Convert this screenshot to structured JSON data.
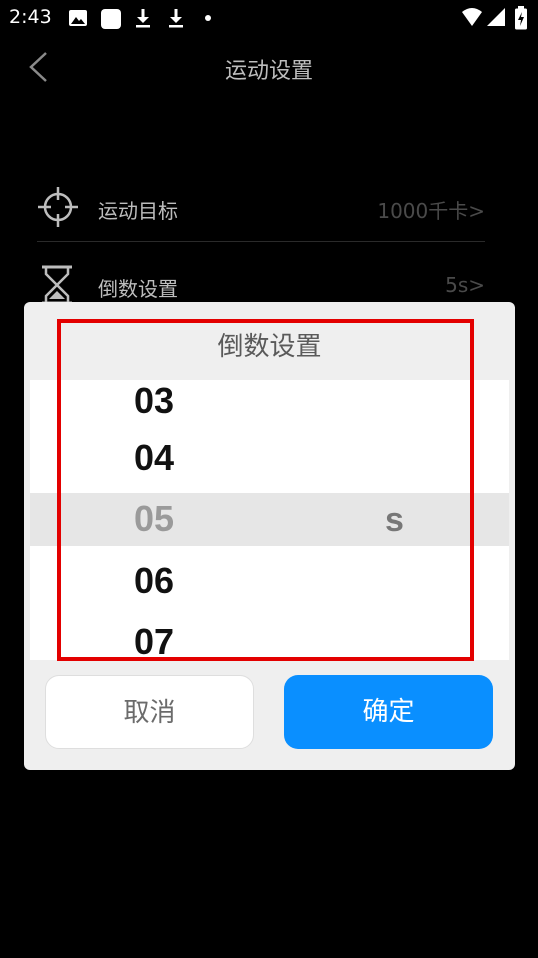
{
  "status_bar": {
    "time": "2:43",
    "icons": [
      "gallery-icon",
      "square-icon",
      "download-icon",
      "download-icon",
      "dot-icon",
      "wifi-icon",
      "signal-icon",
      "battery-icon"
    ]
  },
  "header": {
    "title": "运动设置"
  },
  "settings": {
    "goal": {
      "label": "运动目标",
      "value": "1000千卡>"
    },
    "countdown": {
      "label": "倒数设置",
      "value": "5s>"
    }
  },
  "dialog": {
    "title": "倒数设置",
    "picker_items": [
      "03",
      "04",
      "05",
      "06",
      "07"
    ],
    "selected_value": "05",
    "unit": "s",
    "cancel_label": "取消",
    "confirm_label": "确定"
  },
  "colors": {
    "accent": "#0a8fff",
    "annotation": "#e30000"
  }
}
